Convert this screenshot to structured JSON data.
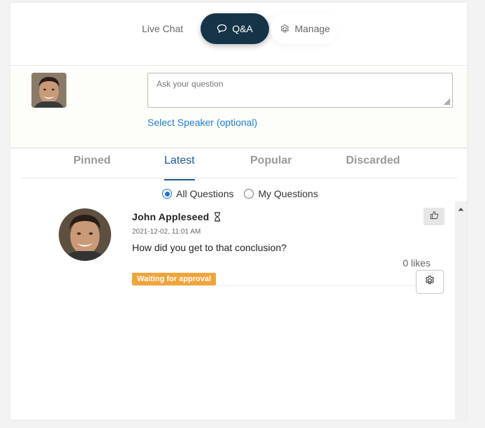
{
  "nav": {
    "tabs": [
      {
        "label": "Live Chat",
        "icon": "none"
      },
      {
        "label": "Q&A",
        "icon": "chat-bubble-icon",
        "active": true
      },
      {
        "label": "Manage",
        "icon": "gear-icon"
      }
    ]
  },
  "ask": {
    "placeholder": "Ask your question",
    "speaker_link": "Select Speaker (optional)"
  },
  "tabs": [
    {
      "label": "Pinned"
    },
    {
      "label": "Latest",
      "active": true
    },
    {
      "label": "Popular"
    },
    {
      "label": "Discarded"
    }
  ],
  "filter": {
    "options": [
      {
        "label": "All Questions",
        "selected": true
      },
      {
        "label": "My Questions",
        "selected": false
      }
    ]
  },
  "question": {
    "author": "John Appleseed",
    "timestamp": "2021-12-02, 11:01 AM",
    "text": "How did you get to that conclusion?",
    "likes": "0 likes",
    "status": "Waiting for approval"
  },
  "colors": {
    "nav_active_bg": "#163447",
    "link_blue": "#1e7fd0",
    "tab_active": "#1c5a8f",
    "badge_bg": "#f0a43a",
    "radio_active": "#1a73d9"
  }
}
